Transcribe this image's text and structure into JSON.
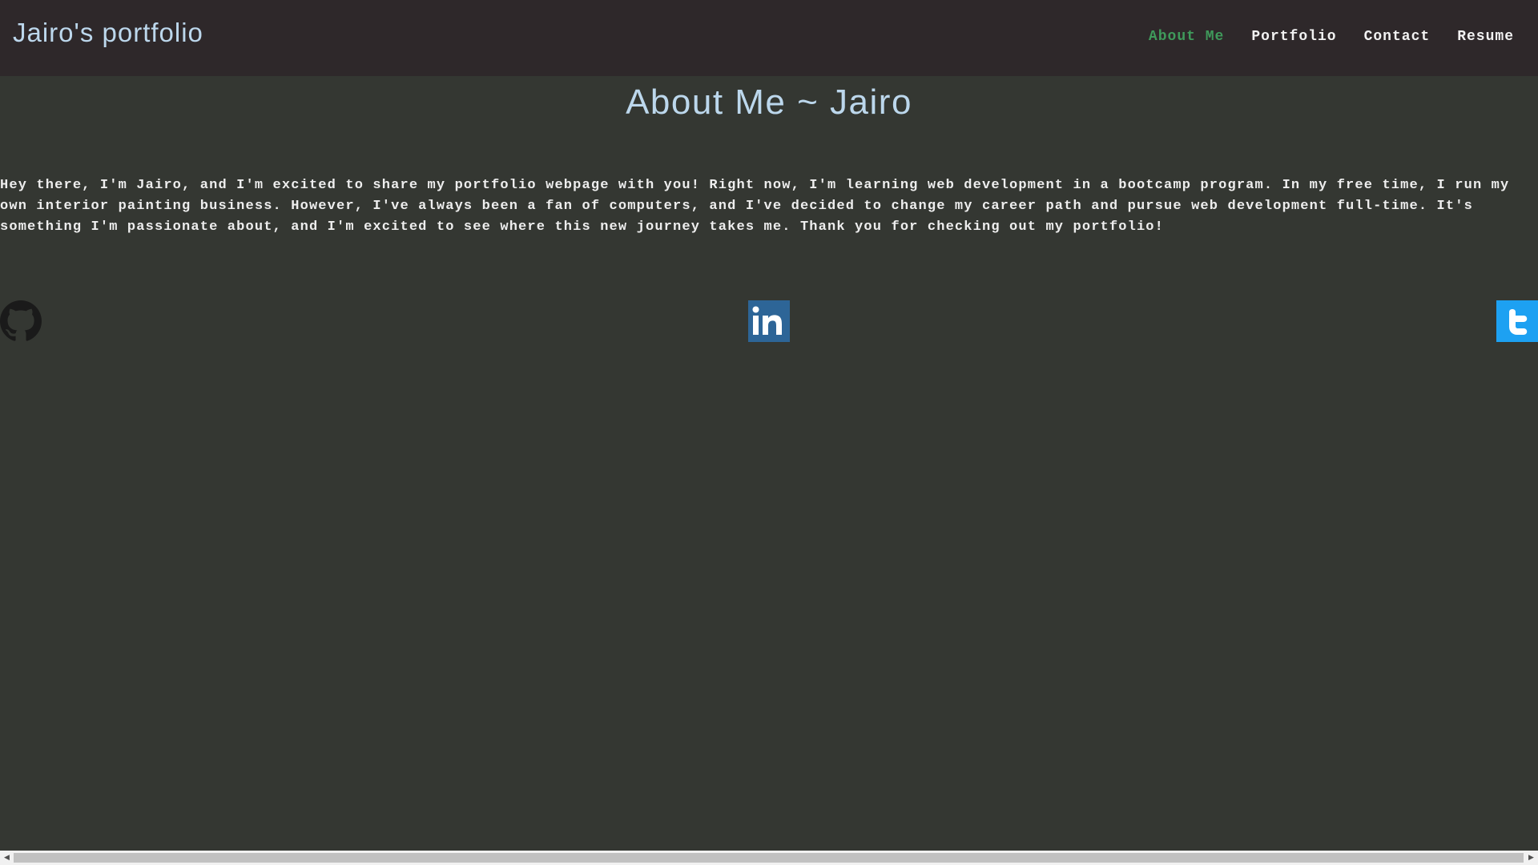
{
  "header": {
    "site_title": "Jairo's portfolio",
    "nav": [
      {
        "label": "About Me",
        "active": true
      },
      {
        "label": "Portfolio",
        "active": false
      },
      {
        "label": "Contact",
        "active": false
      },
      {
        "label": "Resume",
        "active": false
      }
    ]
  },
  "main": {
    "heading": "About Me ~ Jairo",
    "bio": "Hey there, I'm Jairo, and I'm excited to share my portfolio webpage with you! Right now, I'm learning web development in a bootcamp program. In my free time, I run my own interior painting business. However, I've always been a fan of computers, and I've decided to change my career path and pursue web development full-time. It's something I'm passionate about, and I'm excited to see where this new journey takes me. Thank you for checking out my portfolio!"
  },
  "social_links": [
    {
      "icon": "github-icon"
    },
    {
      "icon": "linkedin-icon"
    },
    {
      "icon": "twitter-icon"
    }
  ],
  "scrollbar": {
    "left_arrow": "◀",
    "right_arrow": "▶"
  },
  "colors": {
    "page_background": "#343732",
    "header_background": "#2e282a",
    "title_color": "#bcd7ec",
    "nav_active": "#3f9a5b",
    "nav_default": "#f2f2f2",
    "linkedin_blue": "#2d6597",
    "twitter_blue": "#1da1f2"
  }
}
